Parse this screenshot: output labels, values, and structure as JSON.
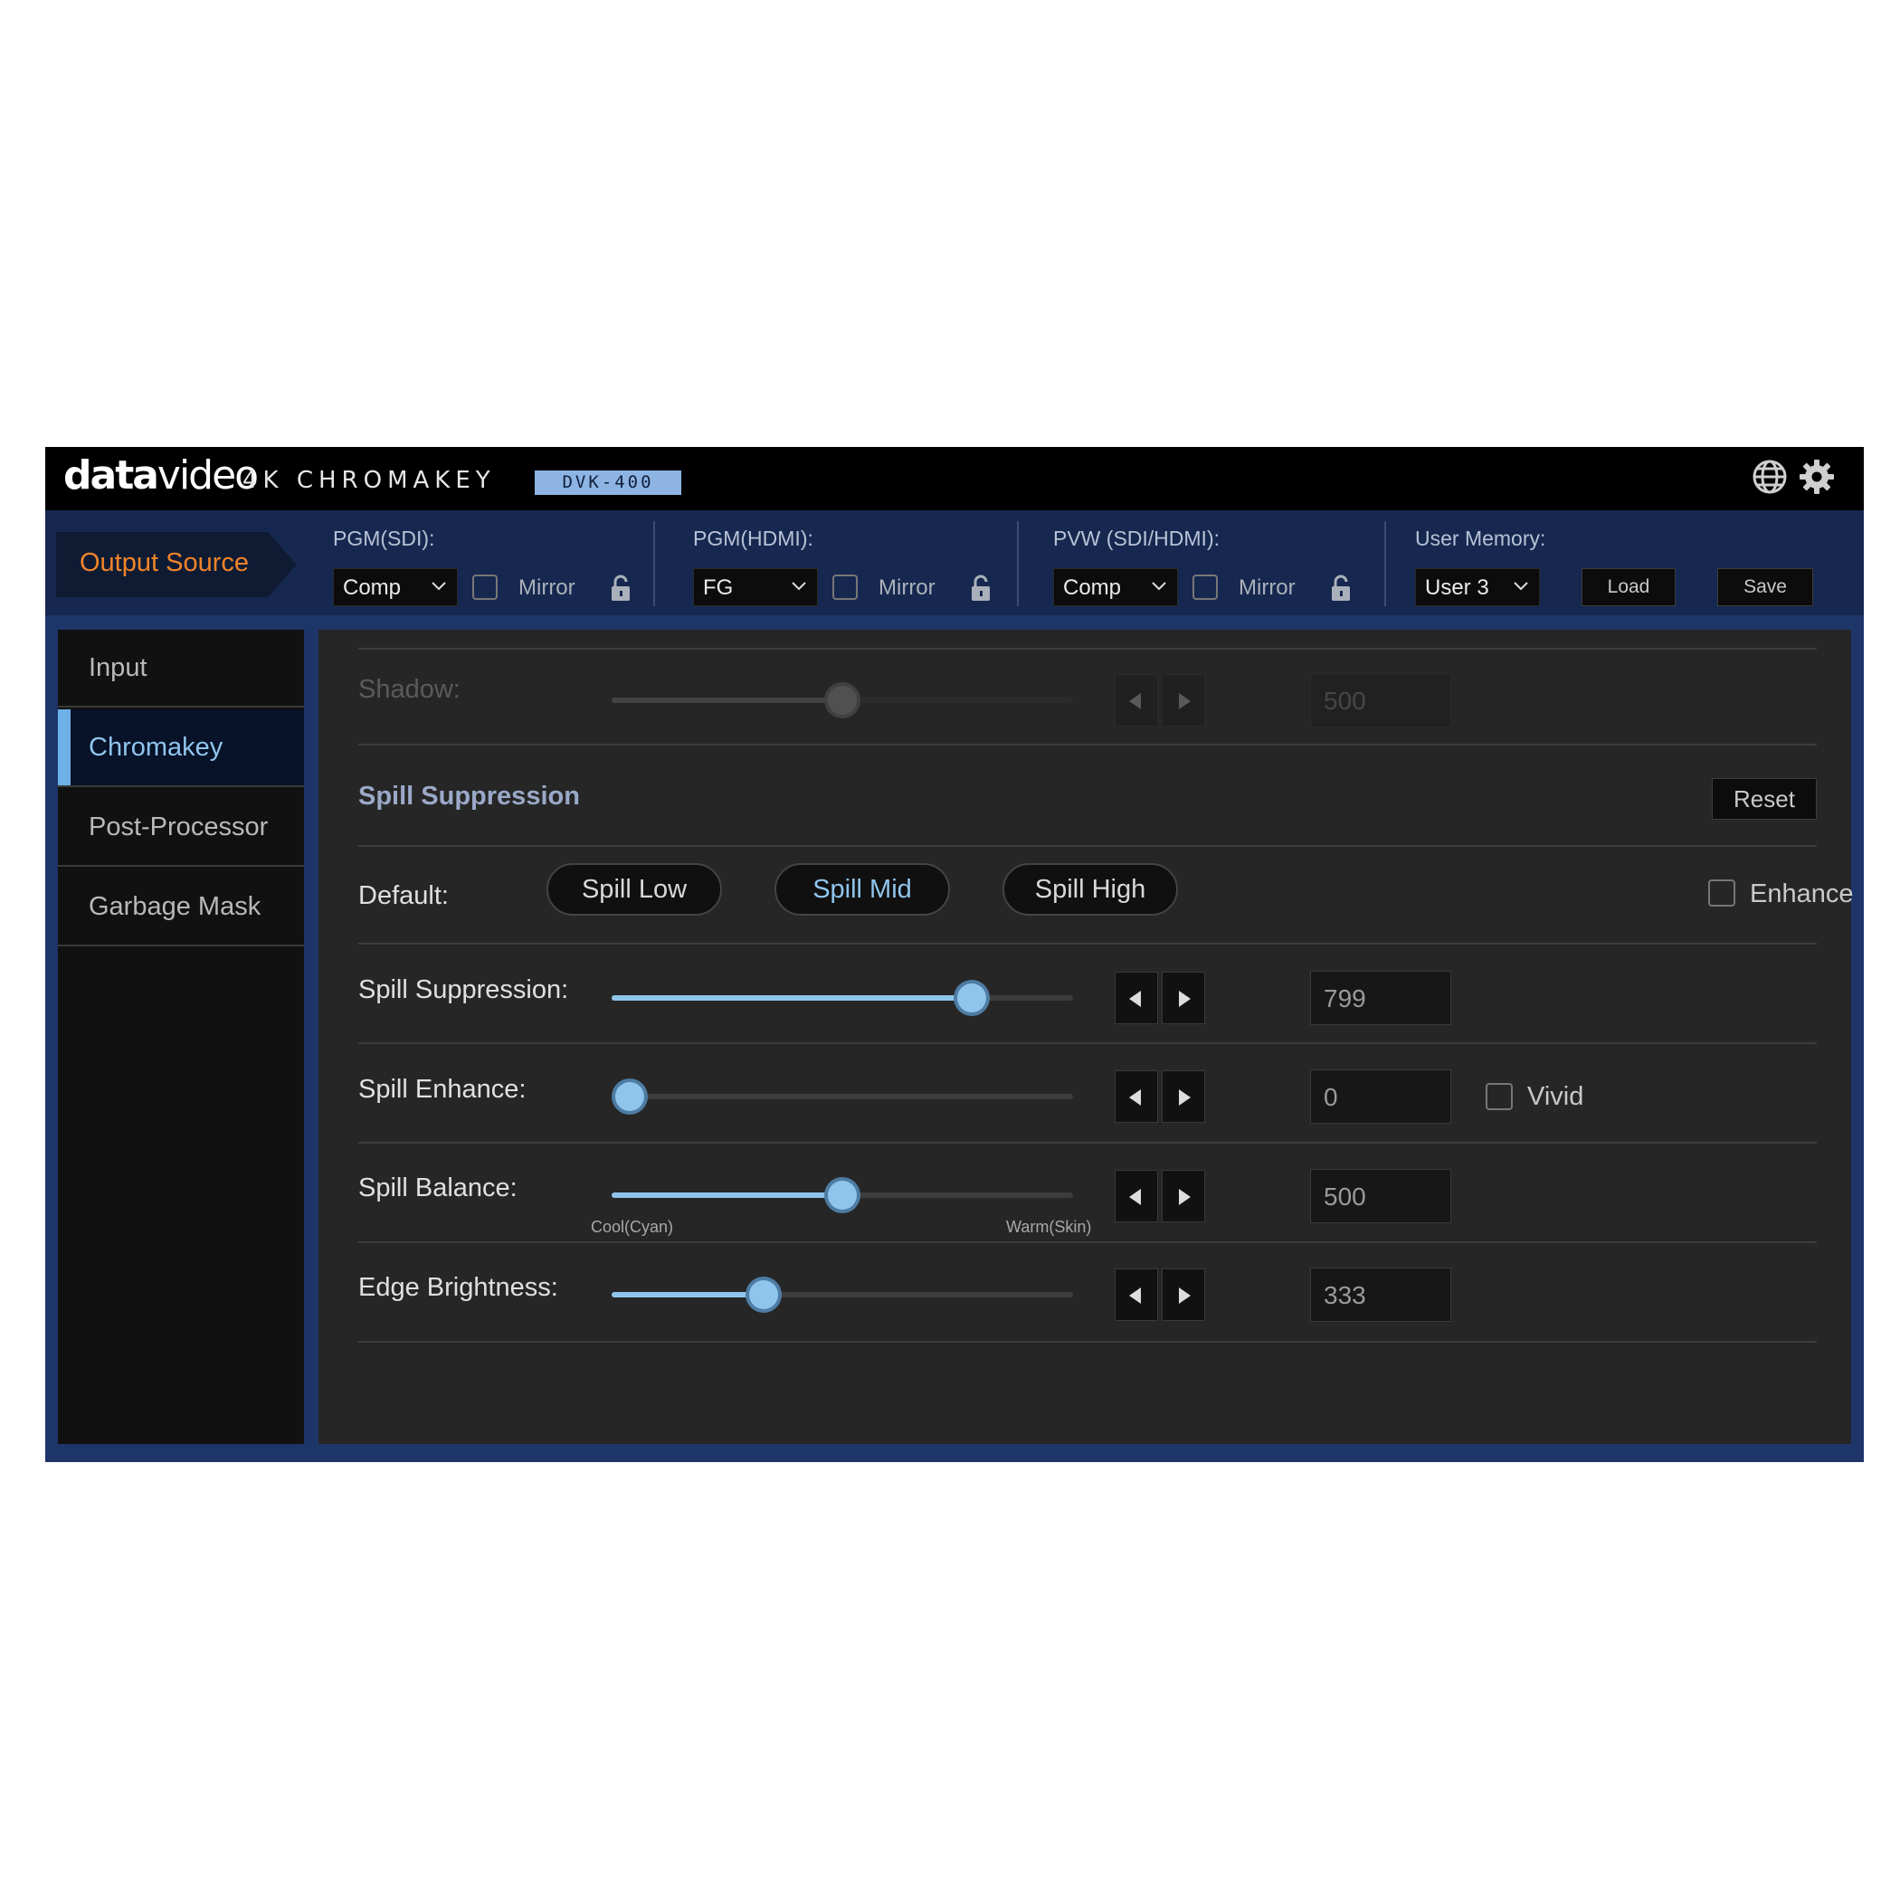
{
  "header": {
    "brand_bold": "data",
    "brand_light": "video",
    "product": "4K CHROMAKEY",
    "model": "DVK-400"
  },
  "output": {
    "title": "Output Source",
    "groups": [
      {
        "label": "PGM(SDI):",
        "value": "Comp",
        "mirror": "Mirror"
      },
      {
        "label": "PGM(HDMI):",
        "value": "FG",
        "mirror": "Mirror"
      },
      {
        "label": "PVW (SDI/HDMI):",
        "value": "Comp",
        "mirror": "Mirror"
      }
    ],
    "memory": {
      "label": "User Memory:",
      "value": "User 3",
      "load": "Load",
      "save": "Save"
    }
  },
  "sidebar": {
    "items": [
      {
        "label": "Input"
      },
      {
        "label": "Chromakey"
      },
      {
        "label": "Post-Processor"
      },
      {
        "label": "Garbage Mask"
      }
    ]
  },
  "main": {
    "shadow": {
      "label": "Shadow:",
      "value": "500",
      "level": 0.5
    },
    "section_title": "Spill Suppression",
    "reset": "Reset",
    "default_label": "Default:",
    "presets": [
      "Spill Low",
      "Spill Mid",
      "Spill High"
    ],
    "enhance": "Enhance",
    "spill_suppression": {
      "label": "Spill Suppression:",
      "value": "799",
      "level": 0.78
    },
    "spill_enhance": {
      "label": "Spill Enhance:",
      "value": "0",
      "vivid": "Vivid",
      "level": 0.0
    },
    "spill_balance": {
      "label": "Spill Balance:",
      "value": "500",
      "min_label": "Cool(Cyan)",
      "max_label": "Warm(Skin)",
      "level": 0.5
    },
    "edge_brightness": {
      "label": "Edge Brightness:",
      "value": "333",
      "level": 0.33
    }
  },
  "colors": {
    "accent": "#8fc5ec",
    "output_source": "#f0842a",
    "model_badge": "#8db4e2"
  },
  "icons": [
    "globe-icon",
    "gear-icon",
    "lock-icon",
    "chevron-down-icon",
    "arrow-left-icon",
    "arrow-right-icon"
  ]
}
